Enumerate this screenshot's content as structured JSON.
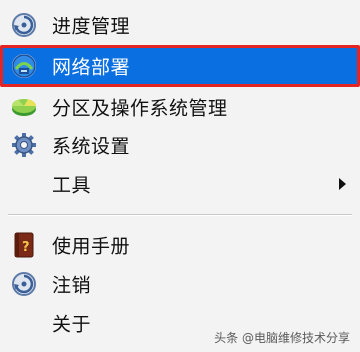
{
  "menu": {
    "items": [
      {
        "label": "进度管理",
        "icon": "progress-icon"
      },
      {
        "label": "网络部署",
        "icon": "network-deploy-icon",
        "selected": true
      },
      {
        "label": "分区及操作系统管理",
        "icon": "partition-icon"
      },
      {
        "label": "系统设置",
        "icon": "gear-icon"
      },
      {
        "label": "工具",
        "icon": "",
        "has_submenu": true
      }
    ],
    "items_after_separator": [
      {
        "label": "使用手册",
        "icon": "manual-book-icon"
      },
      {
        "label": "注销",
        "icon": "logout-icon"
      },
      {
        "label": "关于",
        "icon": ""
      }
    ]
  },
  "watermark": "头条 @电脑维修技术分享",
  "colors": {
    "selected_background": "#0a6fe0",
    "selected_border": "#e52424",
    "menu_background": "#f3f3f3"
  }
}
